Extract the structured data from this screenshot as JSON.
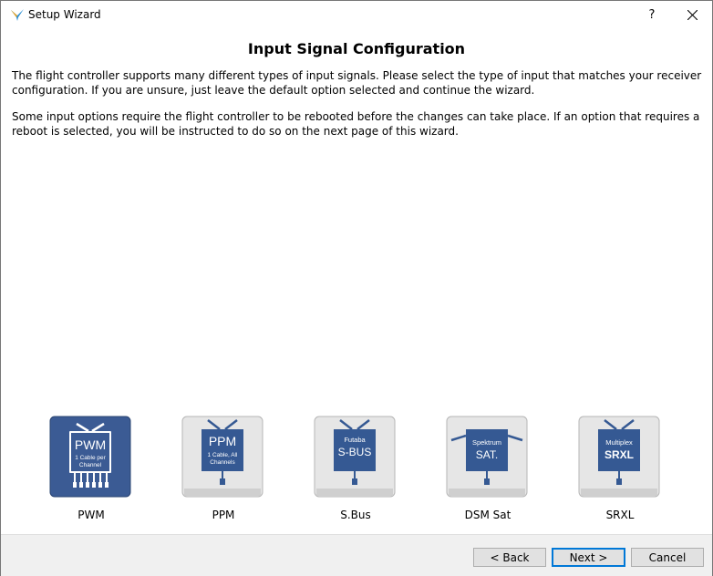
{
  "window": {
    "title": "Setup Wizard",
    "help_label": "?"
  },
  "page": {
    "heading": "Input Signal Configuration",
    "paragraph1": "The flight controller supports many different types of input signals. Please select the type of input that matches your receiver configuration. If you are unsure, just leave the default option selected and continue the wizard.",
    "paragraph2": "Some input options require the flight controller to be rebooted before the changes can take place. If an option that requires a reboot is selected, you will be instructed to do so on the next page of this wizard."
  },
  "options": [
    {
      "label": "PWM",
      "card_line1": "PWM",
      "card_line2": "1 Cable per",
      "card_line3": "Channel",
      "selected": true
    },
    {
      "label": "PPM",
      "card_line1": "PPM",
      "card_line2": "1 Cable, All",
      "card_line3": "Channels",
      "selected": false
    },
    {
      "label": "S.Bus",
      "card_line1": "Futaba",
      "card_line2": "S-BUS",
      "selected": false
    },
    {
      "label": "DSM Sat",
      "card_line1": "Spektrum",
      "card_line2": "SAT.",
      "selected": false
    },
    {
      "label": "SRXL",
      "card_line1": "Multiplex",
      "card_line2": "SRXL",
      "selected": false
    }
  ],
  "buttons": {
    "back": "< Back",
    "next": "Next >",
    "cancel": "Cancel"
  },
  "colors": {
    "selected_tile": "#3b5b94",
    "tile_bg": "#e6e6e6",
    "device_blue": "#355993",
    "focus_border": "#0078d7"
  }
}
